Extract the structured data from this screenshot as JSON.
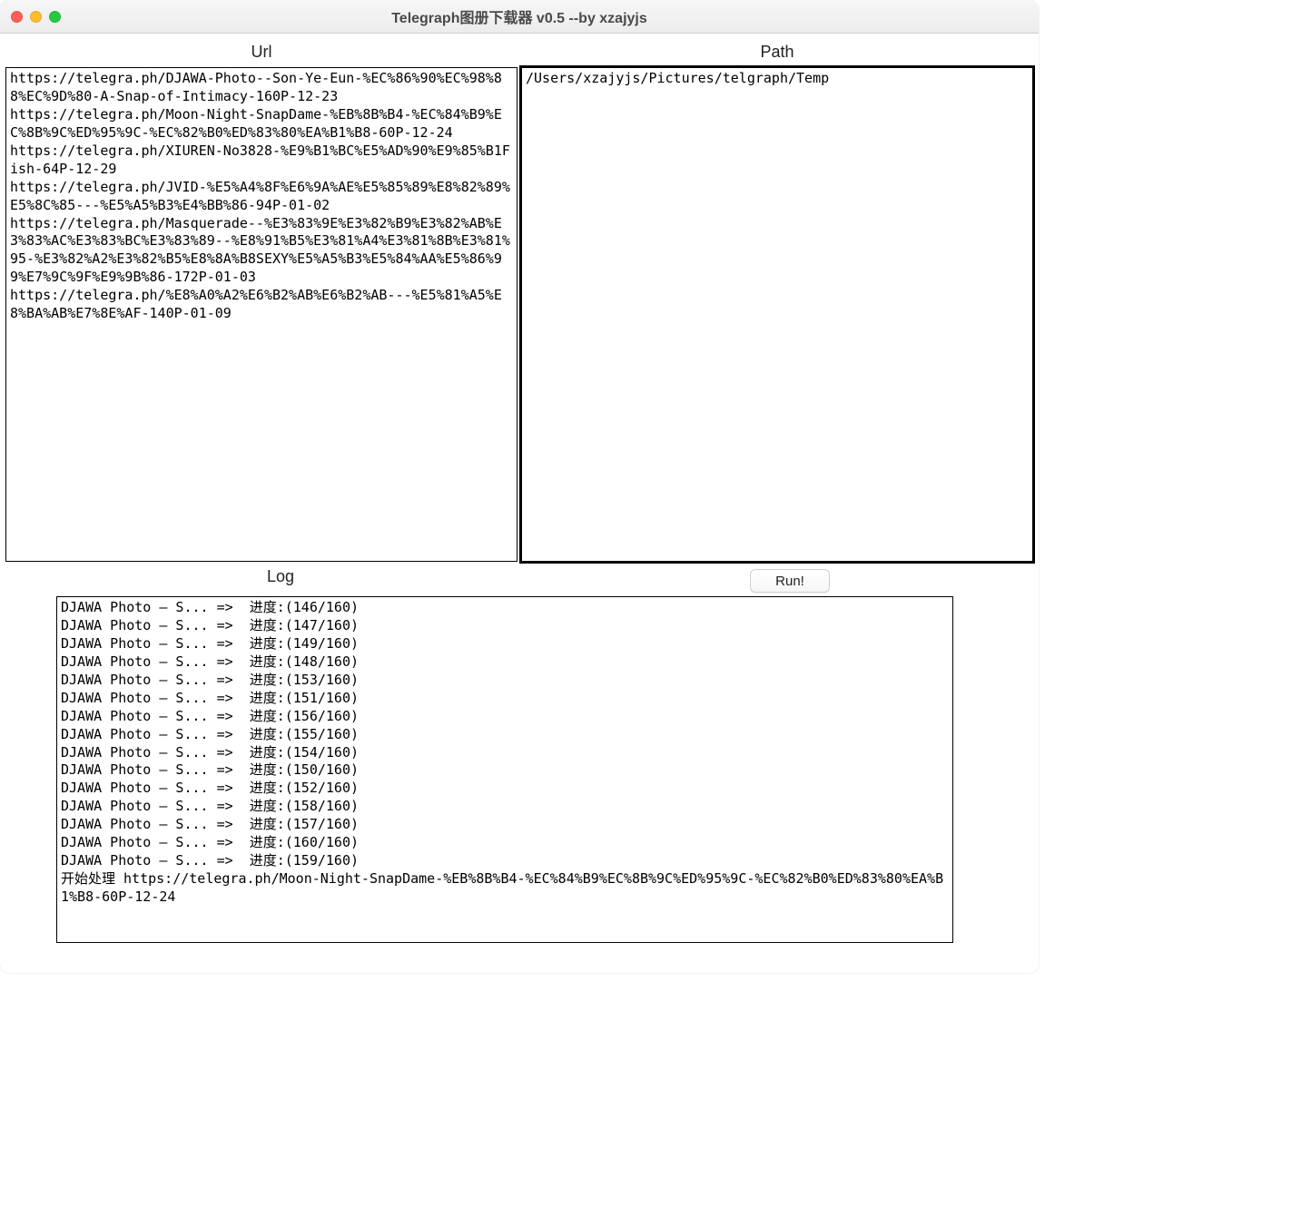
{
  "window": {
    "title": "Telegraph图册下载器 v0.5 --by xzajyjs"
  },
  "labels": {
    "url": "Url",
    "path": "Path",
    "log": "Log",
    "run": "Run!"
  },
  "inputs": {
    "url": "https://telegra.ph/DJAWA-Photo--Son-Ye-Eun-%EC%86%90%EC%98%88%EC%9D%80-A-Snap-of-Intimacy-160P-12-23\nhttps://telegra.ph/Moon-Night-SnapDame-%EB%8B%B4-%EC%84%B9%EC%8B%9C%ED%95%9C-%EC%82%B0%ED%83%80%EA%B1%B8-60P-12-24\nhttps://telegra.ph/XIUREN-No3828-%E9%B1%BC%E5%AD%90%E9%85%B1Fish-64P-12-29\nhttps://telegra.ph/JVID-%E5%A4%8F%E6%9A%AE%E5%85%89%E8%82%89%E5%8C%85---%E5%A5%B3%E4%BB%86-94P-01-02\nhttps://telegra.ph/Masquerade--%E3%83%9E%E3%82%B9%E3%82%AB%E3%83%AC%E3%83%BC%E3%83%89--%E8%91%B5%E3%81%A4%E3%81%8B%E3%81%95-%E3%82%A2%E3%82%B5%E8%8A%B8SEXY%E5%A5%B3%E5%84%AA%E5%86%99%E7%9C%9F%E9%9B%86-172P-01-03\nhttps://telegra.ph/%E8%A0%A2%E6%B2%AB%E6%B2%AB---%E5%81%A5%E8%BA%AB%E7%8E%AF-140P-01-09",
    "path": "/Users/xzajyjs/Pictures/telgraph/Temp"
  },
  "log": "DJAWA Photo – S... =>  进度:(146/160)\nDJAWA Photo – S... =>  进度:(147/160)\nDJAWA Photo – S... =>  进度:(149/160)\nDJAWA Photo – S... =>  进度:(148/160)\nDJAWA Photo – S... =>  进度:(153/160)\nDJAWA Photo – S... =>  进度:(151/160)\nDJAWA Photo – S... =>  进度:(156/160)\nDJAWA Photo – S... =>  进度:(155/160)\nDJAWA Photo – S... =>  进度:(154/160)\nDJAWA Photo – S... =>  进度:(150/160)\nDJAWA Photo – S... =>  进度:(152/160)\nDJAWA Photo – S... =>  进度:(158/160)\nDJAWA Photo – S... =>  进度:(157/160)\nDJAWA Photo – S... =>  进度:(160/160)\nDJAWA Photo – S... =>  进度:(159/160)\n开始处理 https://telegra.ph/Moon-Night-SnapDame-%EB%8B%B4-%EC%84%B9%EC%8B%9C%ED%95%9C-%EC%82%B0%ED%83%80%EA%B1%B8-60P-12-24"
}
